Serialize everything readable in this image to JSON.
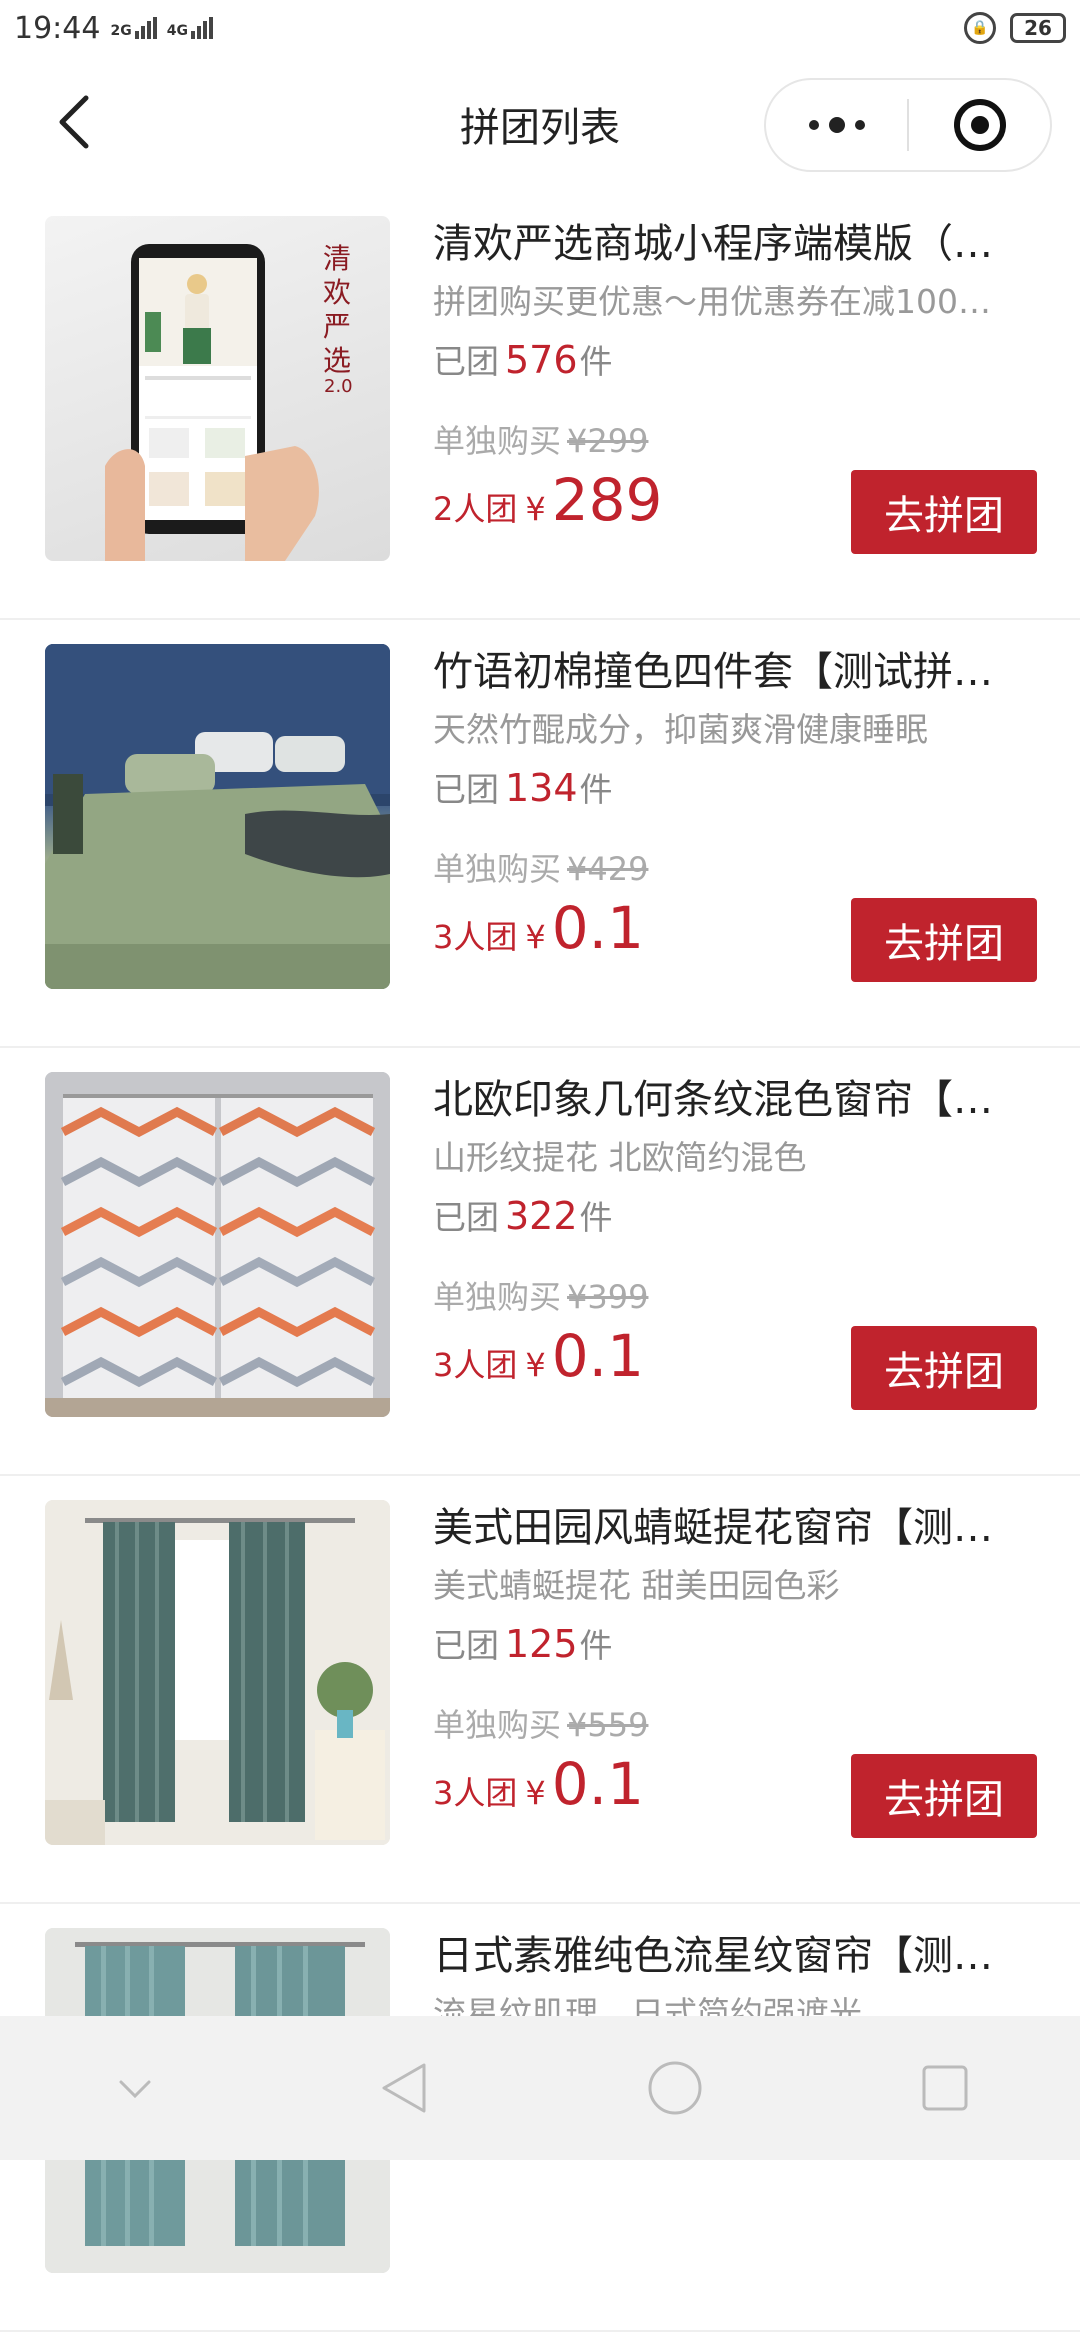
{
  "status_bar": {
    "time": "19:44",
    "net1": "2G",
    "net2": "4G",
    "battery": "26"
  },
  "nav": {
    "title": "拼团列表"
  },
  "items": [
    {
      "title": "清欢严选商城小程序端模版（…",
      "subtitle": "拼团购买更优惠～用优惠券在减100…",
      "sold_prefix": "已团",
      "sold_count": "576",
      "sold_unit": "件",
      "orig_label": "单独购买",
      "orig_price": "¥299",
      "group_size": "2人团",
      "currency": "¥",
      "group_price": "289",
      "button": "去拼团",
      "thumb_icon": "phone-product-image",
      "thumb_text": "清欢严选",
      "thumb_version": "2.0"
    },
    {
      "title": "竹语初棉撞色四件套【测试拼…",
      "subtitle": "天然竹醌成分，抑菌爽滑健康睡眠",
      "sold_prefix": "已团",
      "sold_count": "134",
      "sold_unit": "件",
      "orig_label": "单独购买",
      "orig_price": "¥429",
      "group_size": "3人团",
      "currency": "¥",
      "group_price": "0.1",
      "button": "去拼团",
      "thumb_icon": "bedding-image"
    },
    {
      "title": "北欧印象几何条纹混色窗帘【…",
      "subtitle": "山形纹提花 北欧简约混色",
      "sold_prefix": "已团",
      "sold_count": "322",
      "sold_unit": "件",
      "orig_label": "单独购买",
      "orig_price": "¥399",
      "group_size": "3人团",
      "currency": "¥",
      "group_price": "0.1",
      "button": "去拼团",
      "thumb_icon": "chevron-curtain-image"
    },
    {
      "title": "美式田园风蜻蜓提花窗帘【测…",
      "subtitle": "美式蜻蜓提花 甜美田园色彩",
      "sold_prefix": "已团",
      "sold_count": "125",
      "sold_unit": "件",
      "orig_label": "单独购买",
      "orig_price": "¥559",
      "group_size": "3人团",
      "currency": "¥",
      "group_price": "0.1",
      "button": "去拼团",
      "thumb_icon": "green-curtain-image"
    },
    {
      "title": "日式素雅纯色流星纹窗帘【测…",
      "subtitle": "流星纹肌理，日式简约强遮光",
      "thumb_icon": "teal-curtain-image"
    }
  ],
  "colors": {
    "accent": "#c0232d",
    "muted": "#999999"
  }
}
